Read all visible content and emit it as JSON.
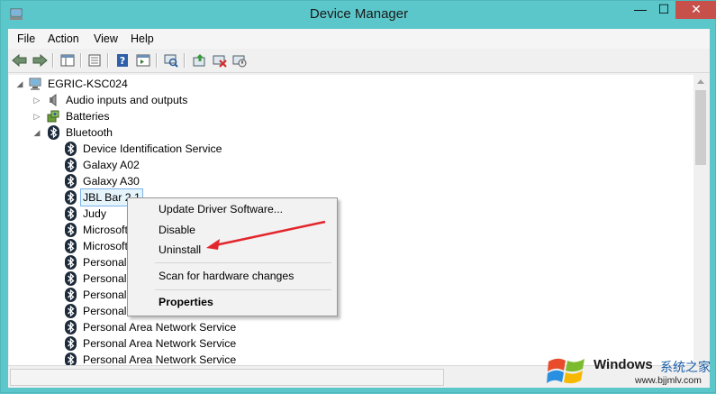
{
  "window": {
    "title": "Device Manager",
    "minimize": "—",
    "maximize": "☐",
    "close": "✕"
  },
  "menubar": [
    "File",
    "Action",
    "View",
    "Help"
  ],
  "toolbar": [
    {
      "name": "back-icon"
    },
    {
      "name": "forward-icon"
    },
    {
      "name": "show-hide-console-tree-icon"
    },
    {
      "name": "properties-icon"
    },
    {
      "name": "help-icon"
    },
    {
      "name": "action-pane-icon"
    },
    {
      "name": "scan-hardware-icon"
    },
    {
      "name": "update-driver-icon"
    },
    {
      "name": "uninstall-device-icon"
    },
    {
      "name": "enable-device-icon"
    }
  ],
  "tree": {
    "root": "EGRIC-KSC024",
    "categories": [
      {
        "label": "Audio inputs and outputs",
        "expander": "▷",
        "icon": "speaker-icon"
      },
      {
        "label": "Batteries",
        "expander": "▷",
        "icon": "battery-icon"
      },
      {
        "label": "Bluetooth",
        "expander": "◢",
        "icon": "bluetooth-icon"
      }
    ],
    "bluetooth_children": [
      "Device Identification Service",
      "Galaxy A02",
      "Galaxy A30",
      "JBL Bar 2.1",
      "Judy",
      "Microsoft",
      "Microsoft",
      "Personal A",
      "Personal A",
      "Personal A",
      "Personal Area Network NAP Service",
      "Personal Area Network Service",
      "Personal Area Network Service",
      "Personal Area Network Service"
    ],
    "selected_index": 3
  },
  "context_menu": {
    "items": [
      "Update Driver Software...",
      "Disable",
      "Uninstall",
      "Scan for hardware changes",
      "Properties"
    ]
  },
  "annotation": {
    "arrow_color": "#e3262c"
  },
  "watermark": {
    "brand": "Windows",
    "brand_cn": "系统之家",
    "url": "www.bjjmlv.com"
  },
  "colors": {
    "titlebar": "#5cc7cb",
    "close_button": "#c7504b",
    "selection": "#e5f3fb"
  }
}
